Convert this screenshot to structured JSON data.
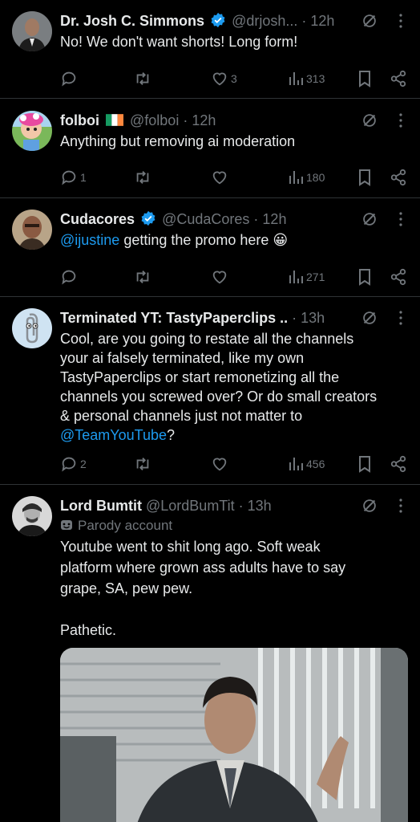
{
  "tweets": [
    {
      "name": "Dr. Josh C. Simmons",
      "handle": "@drjosh...",
      "time": "12h",
      "text": "No! We don't want shorts! Long form!",
      "replies": "",
      "retweets": "",
      "likes": "3",
      "views": "313"
    },
    {
      "name": "folboi",
      "handle": "@folboi",
      "time": "12h",
      "text": "Anything but removing ai moderation",
      "replies": "1",
      "retweets": "",
      "likes": "",
      "views": "180"
    },
    {
      "name": "Cudacores",
      "handle": "@CudaCores",
      "time": "12h",
      "mention": "@ijustine",
      "text": " getting the promo here 😀",
      "replies": "",
      "retweets": "",
      "likes": "",
      "views": "271"
    },
    {
      "name": "Terminated YT: TastyPaperclips ..",
      "handle": "",
      "time": "13h",
      "lines": [
        "Cool, are you going to restate all the channels",
        "your ai falsely terminated, like my own",
        "TastyPaperclips or start remonetizing all the",
        "channels you screwed over? Or do small creators",
        "& personal channels just not matter to"
      ],
      "mention": "@TeamYouTube",
      "tail": "?",
      "replies": "2",
      "retweets": "",
      "likes": "",
      "views": "456"
    },
    {
      "name": "Lord Bumtit",
      "handle": "@LordBumTit",
      "time": "13h",
      "label": "Parody account",
      "lines": [
        "Youtube went to shit long ago. Soft weak",
        "platform where grown ass adults have to say",
        "grape, SA, pew pew.",
        "",
        "Pathetic."
      ]
    }
  ],
  "icons": {
    "reply": "reply-icon",
    "retweet": "retweet-icon",
    "like": "heart-icon",
    "views": "views-icon",
    "bookmark": "bookmark-icon",
    "share": "share-icon",
    "grok": "grok-icon",
    "more": "more-icon"
  },
  "colors": {
    "background": "#000000",
    "text": "#e7e9ea",
    "muted": "#71767b",
    "link": "#1d9bf0",
    "divider": "#2f3336",
    "verified": "#1d9bf0"
  }
}
